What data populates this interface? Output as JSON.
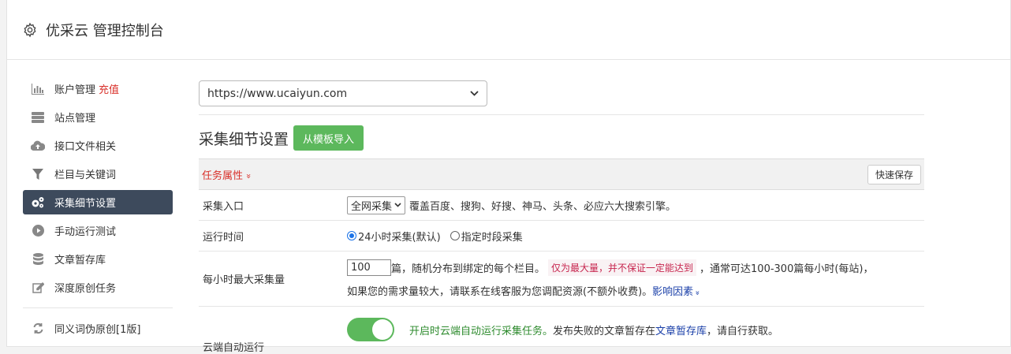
{
  "header": {
    "title": "优采云 管理控制台",
    "icon": "gear-icon"
  },
  "sidebar": {
    "items": [
      {
        "label": "账户管理",
        "extra": "充值",
        "icon": "bar-chart-icon"
      },
      {
        "label": "站点管理",
        "icon": "server-icon"
      },
      {
        "label": "接口文件相关",
        "icon": "cloud-upload-icon"
      },
      {
        "label": "栏目与关键词",
        "icon": "filter-icon"
      },
      {
        "label": "采集细节设置",
        "icon": "cogs-icon",
        "active": true
      },
      {
        "label": "手动运行测试",
        "icon": "play-circle-icon"
      },
      {
        "label": "文章暂存库",
        "icon": "database-icon"
      },
      {
        "label": "深度原创任务",
        "icon": "edit-icon"
      },
      {
        "label": "同义词伪原创[1版]",
        "icon": "refresh-icon"
      }
    ]
  },
  "main": {
    "site_select": "https://www.ucaiyun.com",
    "section_title": "采集细节设置",
    "import_button": "从模板导入",
    "task_label": "任务属性",
    "task_chevron": "»",
    "save_button": "快速保存",
    "rows": {
      "entry": {
        "label": "采集入口",
        "select": "全网采集",
        "desc": "覆盖百度、搜狗、好搜、神马、头条、必应六大搜索引擎。"
      },
      "time": {
        "label": "运行时间",
        "opt1": "24小时采集(默认)",
        "opt2": "指定时段采集"
      },
      "max": {
        "label": "每小时最大采集量",
        "value": "100",
        "text1": "篇，随机分布到绑定的每个栏目。",
        "warn": "仅为最大量，并不保证一定能达到",
        "text2": "，通常可达100-300篇每小时(每站)，",
        "text3": "如果您的需求量较大，请联系在线客服为您调配资源(不额外收费)。",
        "link": "影响因素",
        "link_chevron": "»"
      },
      "cloud": {
        "label": "云端自动运行",
        "green": "开启时云端自动运行采集任务。",
        "text": "发布失败的文章暂存在",
        "link": "文章暂存库",
        "text2": "，请自行获取。"
      }
    }
  },
  "colors": {
    "active_nav": "#3d4a5c",
    "green": "#5cb85c",
    "red": "#d9312b",
    "link": "#1a3fa8"
  }
}
